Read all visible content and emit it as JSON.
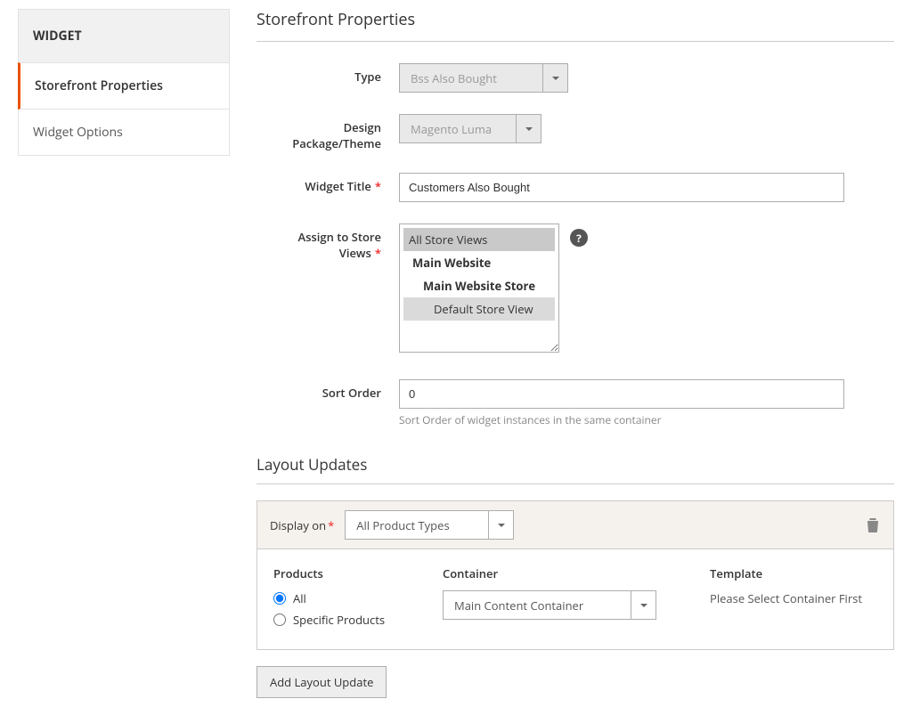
{
  "sidebar": {
    "header": "WIDGET",
    "items": [
      {
        "label": "Storefront Properties",
        "active": true
      },
      {
        "label": "Widget Options",
        "active": false
      }
    ]
  },
  "section_title": "Storefront Properties",
  "form": {
    "type": {
      "label": "Type",
      "value": "Bss Also Bought"
    },
    "theme": {
      "label": "Design Package/Theme",
      "value": "Magento Luma"
    },
    "title": {
      "label": "Widget Title",
      "value": "Customers Also Bought"
    },
    "stores": {
      "label": "Assign to Store Views",
      "opt_all": "All Store Views",
      "group_website": "Main Website",
      "group_store": "Main Website Store",
      "opt_default": "Default Store View"
    },
    "sort": {
      "label": "Sort Order",
      "value": "0",
      "note": "Sort Order of widget instances in the same container"
    }
  },
  "layout_updates": {
    "title": "Layout Updates",
    "display_on_label": "Display on",
    "display_on_value": "All Product Types",
    "col_products": "Products",
    "col_container": "Container",
    "col_template": "Template",
    "radio_all": "All",
    "radio_specific": "Specific Products",
    "container_value": "Main Content Container",
    "template_text": "Please Select Container First",
    "add_button": "Add Layout Update"
  }
}
